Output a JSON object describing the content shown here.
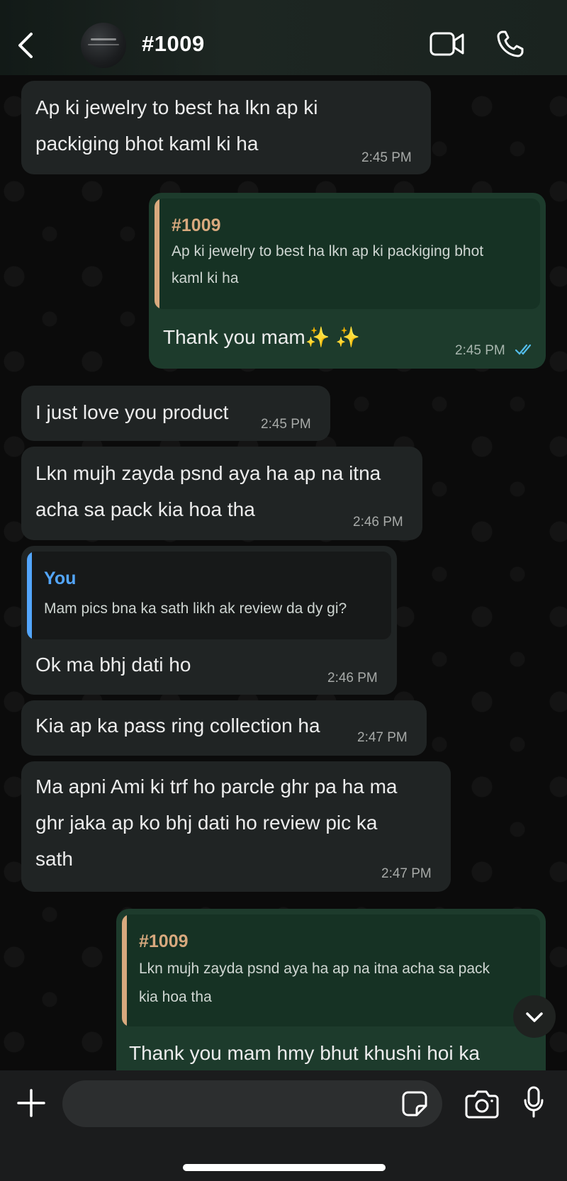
{
  "header": {
    "contact_name": "#1009",
    "back_icon": "chevron-left-icon",
    "video_icon": "video-camera-icon",
    "call_icon": "phone-icon"
  },
  "messages": [
    {
      "direction": "incoming",
      "text_lines": [
        "Ap ki jewelry to best ha lkn ap ki",
        "packiging bhot kaml ki ha"
      ],
      "time": "2:45 PM"
    },
    {
      "direction": "outgoing",
      "quote": {
        "author": "#1009",
        "text_lines": [
          "Ap ki jewelry to best ha lkn ap ki packiging bhot",
          "kaml ki ha"
        ]
      },
      "text": "Thank you mam✨ ✨",
      "time": "2:45 PM",
      "read": true
    },
    {
      "direction": "incoming",
      "text": "I just love you product",
      "time": "2:45 PM"
    },
    {
      "direction": "incoming",
      "text_lines": [
        "Lkn mujh zayda psnd aya ha ap na itna",
        "acha sa pack kia hoa tha"
      ],
      "time": "2:46 PM"
    },
    {
      "direction": "incoming",
      "quote": {
        "author": "You",
        "text": "Mam pics bna ka sath likh ak review da dy gi?"
      },
      "text": "Ok ma bhj dati ho",
      "time": "2:46 PM"
    },
    {
      "direction": "incoming",
      "text": "Kia ap ka pass ring collection ha",
      "time": "2:47 PM"
    },
    {
      "direction": "incoming",
      "text_lines": [
        "Ma apni Ami ki trf ho parcle ghr pa ha  ma",
        "ghr jaka ap ko bhj dati ho review pic ka",
        "sath"
      ],
      "time": "2:47 PM"
    },
    {
      "direction": "outgoing",
      "quote": {
        "author": "#1009",
        "text_lines": [
          "Lkn mujh zayda psnd aya ha ap na itna acha sa pack",
          "kia hoa tha"
        ]
      },
      "text": "Thank you mam hmy bhut khushi hoi ka"
    }
  ],
  "composer": {
    "placeholder": "",
    "value": ""
  },
  "colors": {
    "outgoing_bubble": "#1d3b2c",
    "incoming_bubble": "#202424",
    "quote_outgoing_accent": "#d8a97e",
    "quote_you_accent": "#53a6fd",
    "read_ticks": "#53bdeb"
  }
}
